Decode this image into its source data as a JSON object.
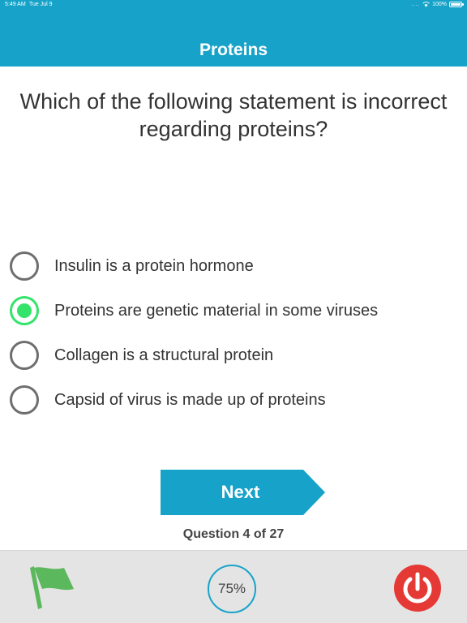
{
  "status_bar": {
    "time": "5:49 AM",
    "date": "Tue Jul 9",
    "signal": "....",
    "battery": "100%"
  },
  "header": {
    "title": "Proteins",
    "color": "#17a3c9"
  },
  "question": {
    "text": "Which of the following statement is incorrect regarding proteins?"
  },
  "options": [
    {
      "label": "Insulin is a protein hormone",
      "selected": false
    },
    {
      "label": "Proteins are genetic material in some viruses",
      "selected": true
    },
    {
      "label": "Collagen is a structural protein",
      "selected": false
    },
    {
      "label": "Capsid of virus is made up of proteins",
      "selected": false
    }
  ],
  "next_button": {
    "label": "Next"
  },
  "counter": {
    "text": "Question 4 of 27"
  },
  "footer": {
    "flag_icon": "flag-icon",
    "progress": "75%",
    "power_icon": "power-icon"
  },
  "colors": {
    "accent": "#17a3c9",
    "selected": "#34e36a",
    "flag": "#5cb85c",
    "power": "#e53935"
  }
}
